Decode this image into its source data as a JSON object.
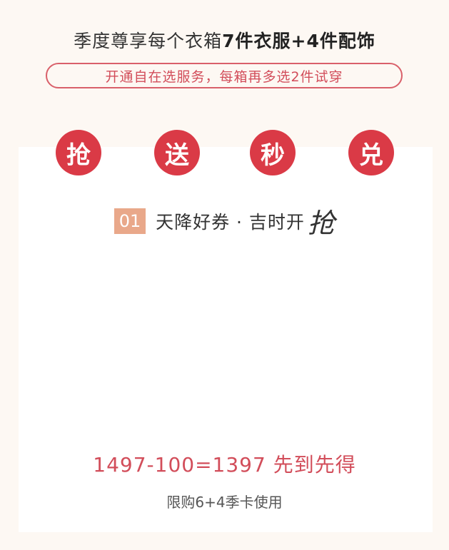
{
  "header": {
    "title_prefix": "季度尊享每个衣箱",
    "title_strong": "7件衣服+4件配饰",
    "subtitle": "开通自在选服务，每箱再多选2件试穿"
  },
  "activities": [
    "抢",
    "送",
    "秒",
    "兑"
  ],
  "section": {
    "number": "01",
    "title": "天降好券 · 吉时开",
    "emphasis": "抢"
  },
  "promo": {
    "price_line": "1497-100=1397 先到先得",
    "note": "限购6+4季卡使用"
  },
  "colors": {
    "accent": "#da3a46",
    "badge": "#e9a88a",
    "page_bg": "#fdf8f3"
  }
}
